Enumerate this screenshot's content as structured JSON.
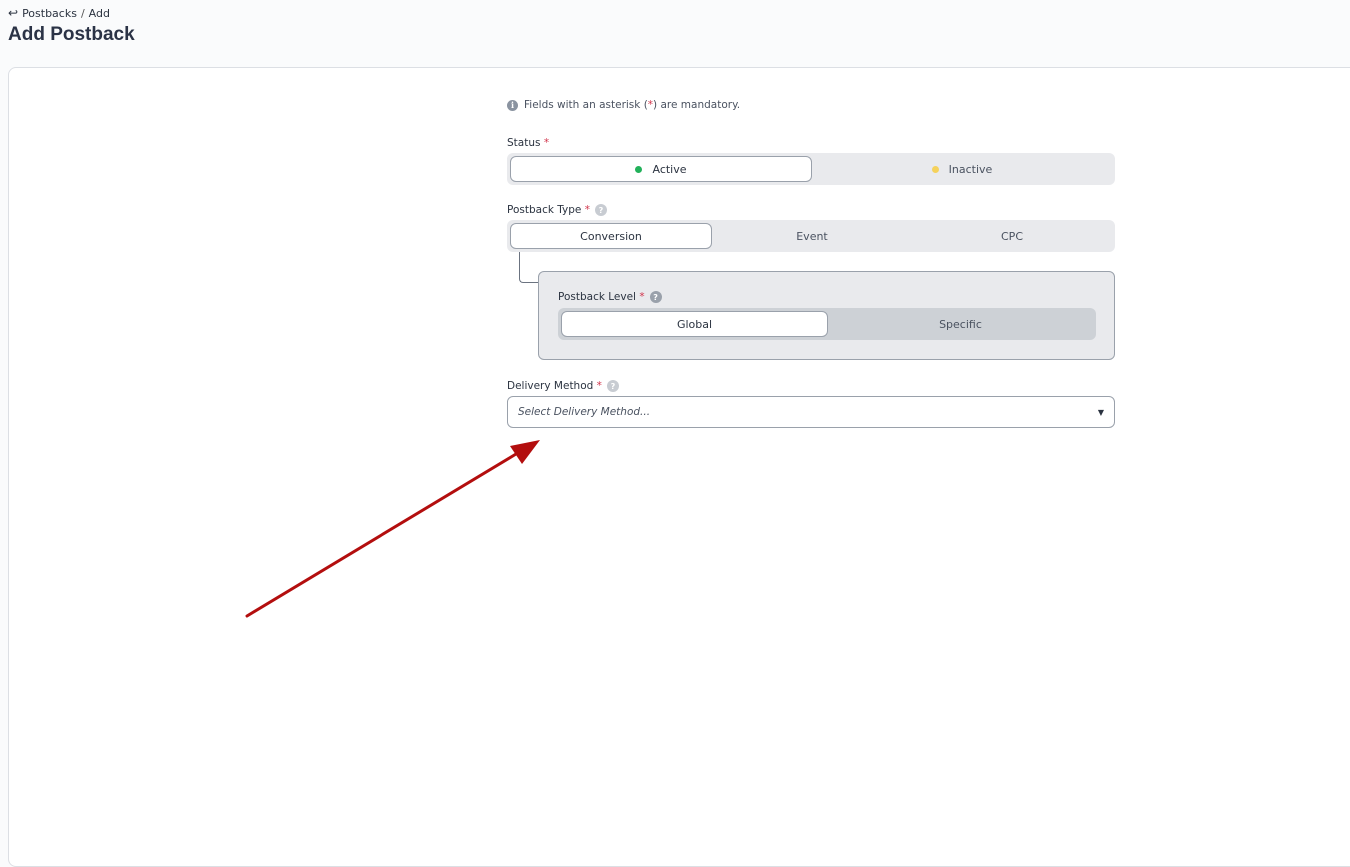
{
  "breadcrumb": {
    "back_icon": "↩",
    "parent": "Postbacks",
    "separator": "/",
    "current": "Add"
  },
  "page_title": "Add Postback",
  "form": {
    "note_prefix": "Fields with an asterisk (",
    "note_asterisk": "*",
    "note_suffix": ") are mandatory.",
    "status": {
      "label": "Status",
      "options": [
        {
          "label": "Active",
          "dot_color": "#22b15a",
          "selected": true
        },
        {
          "label": "Inactive",
          "dot_color": "#f5d25c",
          "selected": false
        }
      ]
    },
    "postback_type": {
      "label": "Postback Type",
      "options": [
        {
          "label": "Conversion",
          "selected": true
        },
        {
          "label": "Event",
          "selected": false
        },
        {
          "label": "CPC",
          "selected": false
        }
      ]
    },
    "postback_level": {
      "label": "Postback Level",
      "options": [
        {
          "label": "Global",
          "selected": true
        },
        {
          "label": "Specific",
          "selected": false
        }
      ]
    },
    "delivery_method": {
      "label": "Delivery Method",
      "placeholder": "Select Delivery Method...",
      "caret": "▼"
    },
    "asterisk": "*",
    "help_icon": "?",
    "info_icon": "i"
  },
  "annotation_arrow_color": "#b30e0e"
}
